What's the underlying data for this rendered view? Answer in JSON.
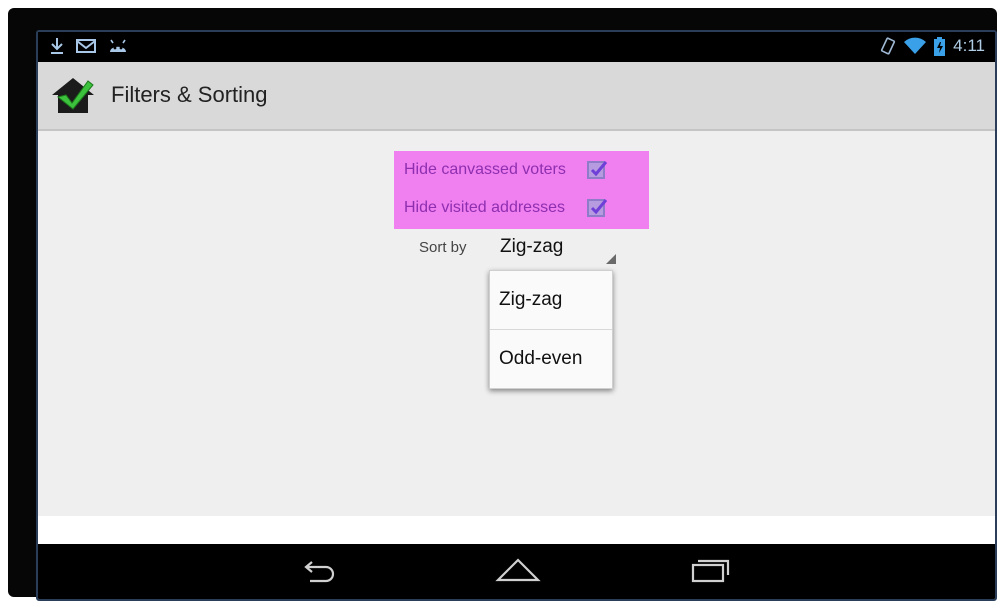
{
  "screen": {
    "title": "Filters & Sorting"
  },
  "status_bar": {
    "time": "4:11",
    "icons_left": [
      "download-icon",
      "gmail-icon",
      "android-icon"
    ],
    "icons_right": [
      "vibrate-icon",
      "wifi-icon",
      "battery-icon"
    ]
  },
  "filters": [
    {
      "label": "Hide canvassed voters",
      "checked": true
    },
    {
      "label": "Hide visited addresses",
      "checked": true
    }
  ],
  "sort": {
    "label": "Sort by",
    "selected": "Zig-zag",
    "options": [
      "Zig-zag",
      "Odd-even"
    ]
  },
  "nav": [
    "back-icon",
    "home-icon",
    "recents-icon"
  ],
  "colors": {
    "highlight": "#f07ff0",
    "filter_text": "#8e2fb0",
    "action_bar": "#d9d9d9",
    "content_bg": "#efefef",
    "status_text": "#a9c8e8"
  }
}
